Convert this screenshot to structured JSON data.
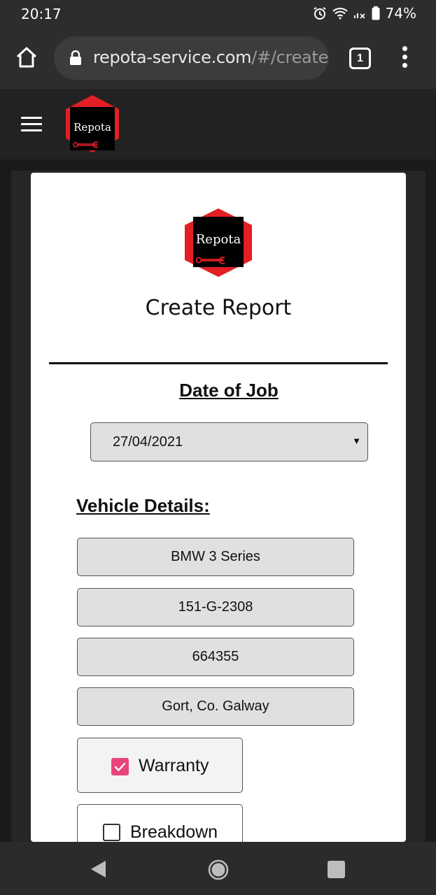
{
  "status_bar": {
    "time": "20:17",
    "battery": "74%",
    "icons": [
      "alarm-icon",
      "wifi-icon",
      "signal-icon",
      "battery-icon"
    ]
  },
  "browser": {
    "url_domain": "repota-service.com",
    "url_path": "/#/create",
    "tab_count": "1"
  },
  "app": {
    "logo_text": "Repota",
    "brand_color": "#e31e24"
  },
  "card": {
    "title": "Create Report",
    "date_heading": "Date of Job",
    "date_value": "27/04/2021",
    "vehicle_heading": "Vehicle Details:",
    "fields": [
      "BMW 3 Series",
      "151-G-2308",
      "664355",
      "Gort, Co. Galway"
    ],
    "checkboxes": [
      {
        "label": "Warranty",
        "checked": true
      },
      {
        "label": "Breakdown",
        "checked": false
      }
    ],
    "accent_color": "#e8457a"
  }
}
